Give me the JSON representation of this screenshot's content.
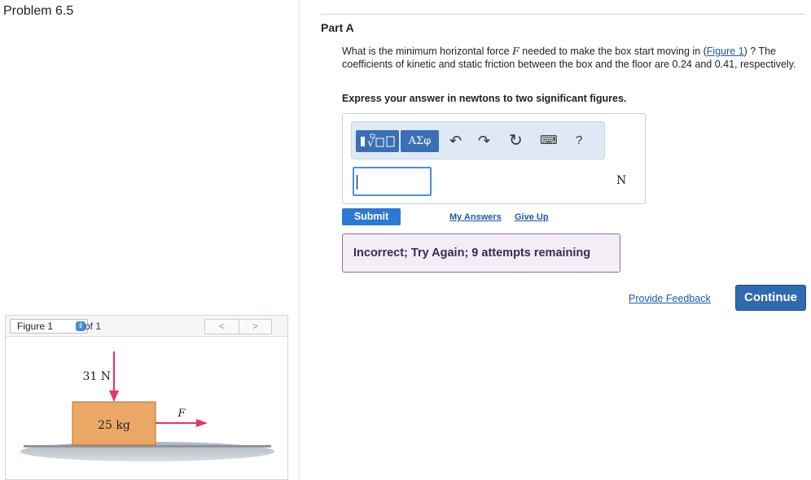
{
  "problem": {
    "title": "Problem 6.5"
  },
  "figure": {
    "select_value": "Figure 1",
    "of_label": "of 1",
    "prev": "<",
    "next": ">",
    "force_down_label": "31 N",
    "mass_label": "25 kg",
    "force_var": "F",
    "colors": {
      "arrow": "#e8326a",
      "box": "#e8a25f",
      "box_border": "#b86c2a",
      "ground": "#bfc6cc"
    }
  },
  "part": {
    "label": "Part A",
    "question_pre": "What is the minimum horizontal force ",
    "question_var": "F",
    "question_mid": " needed to make the box start moving in (",
    "question_link": "Figure 1",
    "question_post": ") ? The coefficients of kinetic and static friction between the box and the floor are 0.24 and 0.41, respectively.",
    "instructions": "Express your answer in newtons to two significant figures."
  },
  "answer": {
    "templates_icon": "templates-icon",
    "symbols_label": "ΑΣφ",
    "help_label": "?",
    "input_value": "",
    "unit": "N"
  },
  "actions": {
    "submit": "Submit",
    "my_answers": "My Answers",
    "give_up": "Give Up"
  },
  "feedback": {
    "message": "Incorrect; Try Again; 9 attempts remaining"
  },
  "footer": {
    "provide_feedback": "Provide Feedback",
    "continue": "Continue"
  }
}
